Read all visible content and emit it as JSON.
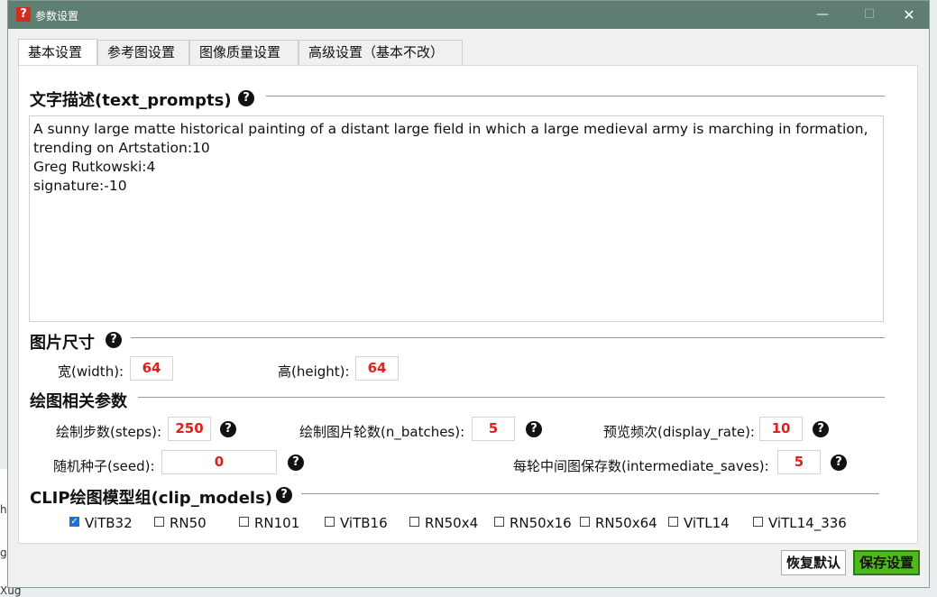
{
  "background_fragments": [
    "h",
    "g",
    "Xug"
  ],
  "window": {
    "icon_glyph": "?",
    "title": "参数设置",
    "minimize_glyph": "—",
    "maximize_glyph": "☐",
    "close_glyph": "✕"
  },
  "tabs": [
    {
      "label": "基本设置",
      "active": true
    },
    {
      "label": "参考图设置",
      "active": false
    },
    {
      "label": "图像质量设置",
      "active": false
    },
    {
      "label": "高级设置（基本不改）",
      "active": false
    }
  ],
  "help_glyph": "?",
  "prompts": {
    "title": "文字描述(text_prompts)",
    "text": "A sunny large matte historical painting of a distant large field in which a large medieval army is marching in formation,\ntrending on Artstation:10\nGreg Rutkowski:4\nsignature:-10"
  },
  "size": {
    "title": "图片尺寸",
    "width_label": "宽(width):",
    "width_value": "64",
    "height_label": "高(height):",
    "height_value": "64"
  },
  "draw": {
    "title": "绘图相关参数",
    "steps_label": "绘制步数(steps):",
    "steps_value": "250",
    "batches_label": "绘制图片轮数(n_batches):",
    "batches_value": "5",
    "display_rate_label": "预览频次(display_rate):",
    "display_rate_value": "10",
    "seed_label": "随机种子(seed):",
    "seed_value": "0",
    "saves_label": "每轮中间图保存数(intermediate_saves):",
    "saves_value": "5"
  },
  "clip": {
    "title": "CLIP绘图模型组(clip_models)",
    "models": [
      {
        "label": "ViTB32",
        "checked": true
      },
      {
        "label": "RN50",
        "checked": false
      },
      {
        "label": "RN101",
        "checked": false
      },
      {
        "label": "ViTB16",
        "checked": false
      },
      {
        "label": "RN50x4",
        "checked": false
      },
      {
        "label": "RN50x16",
        "checked": false
      },
      {
        "label": "RN50x64",
        "checked": false
      },
      {
        "label": "ViTL14",
        "checked": false
      },
      {
        "label": "ViTL14_336",
        "checked": false
      }
    ]
  },
  "buttons": {
    "reset": "恢复默认",
    "save": "保存设置"
  },
  "colors": {
    "titlebar": "#5d7e71",
    "value_text": "#e0201a",
    "save_button": "#4fb81f",
    "checkbox_checked": "#1a73d0"
  }
}
